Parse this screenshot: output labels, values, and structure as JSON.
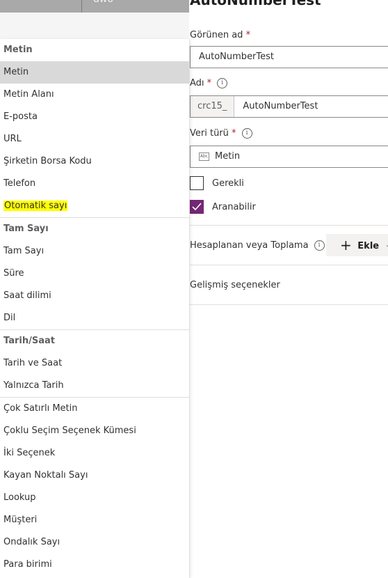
{
  "topbar": {
    "cell_text": "dwo"
  },
  "panel": {
    "title": "AutoNumberTest",
    "display_name_label": "Görünen ad",
    "display_name_value": "AutoNumberTest",
    "name_label": "Adı",
    "name_prefix": "crc15_",
    "name_value": "AutoNumberTest",
    "datatype_label": "Veri türü",
    "datatype_value": "Metin",
    "required_label": "Gerekli",
    "searchable_label": "Aranabilir",
    "calc_label": "Hesaplanan veya Toplama",
    "add_label": "Ekle",
    "advanced_label": "Gelişmiş seçenekler",
    "required_mark": "*",
    "accent_color": "#742774"
  },
  "dropdown": {
    "groups": [
      {
        "header": "Metin",
        "items": [
          "Metin",
          "Metin Alanı",
          "E-posta",
          "URL",
          "Şirketin Borsa Kodu",
          "Telefon",
          "Otomatik sayı"
        ]
      },
      {
        "header": "Tam Sayı",
        "items": [
          "Tam Sayı",
          "Süre",
          "Saat dilimi",
          "Dil"
        ]
      },
      {
        "header": "Tarih/Saat",
        "items": [
          "Tarih ve Saat",
          "Yalnızca Tarih"
        ]
      },
      {
        "header": "",
        "items": [
          "Çok Satırlı Metin",
          "Çoklu Seçim Seçenek Kümesi",
          "İki Seçenek",
          "Kayan Noktalı Sayı",
          "Lookup",
          "Müşteri",
          "Ondalık Sayı",
          "Para birimi"
        ]
      }
    ],
    "selected_item": "Metin",
    "highlighted_item": "Otomatik sayı"
  }
}
